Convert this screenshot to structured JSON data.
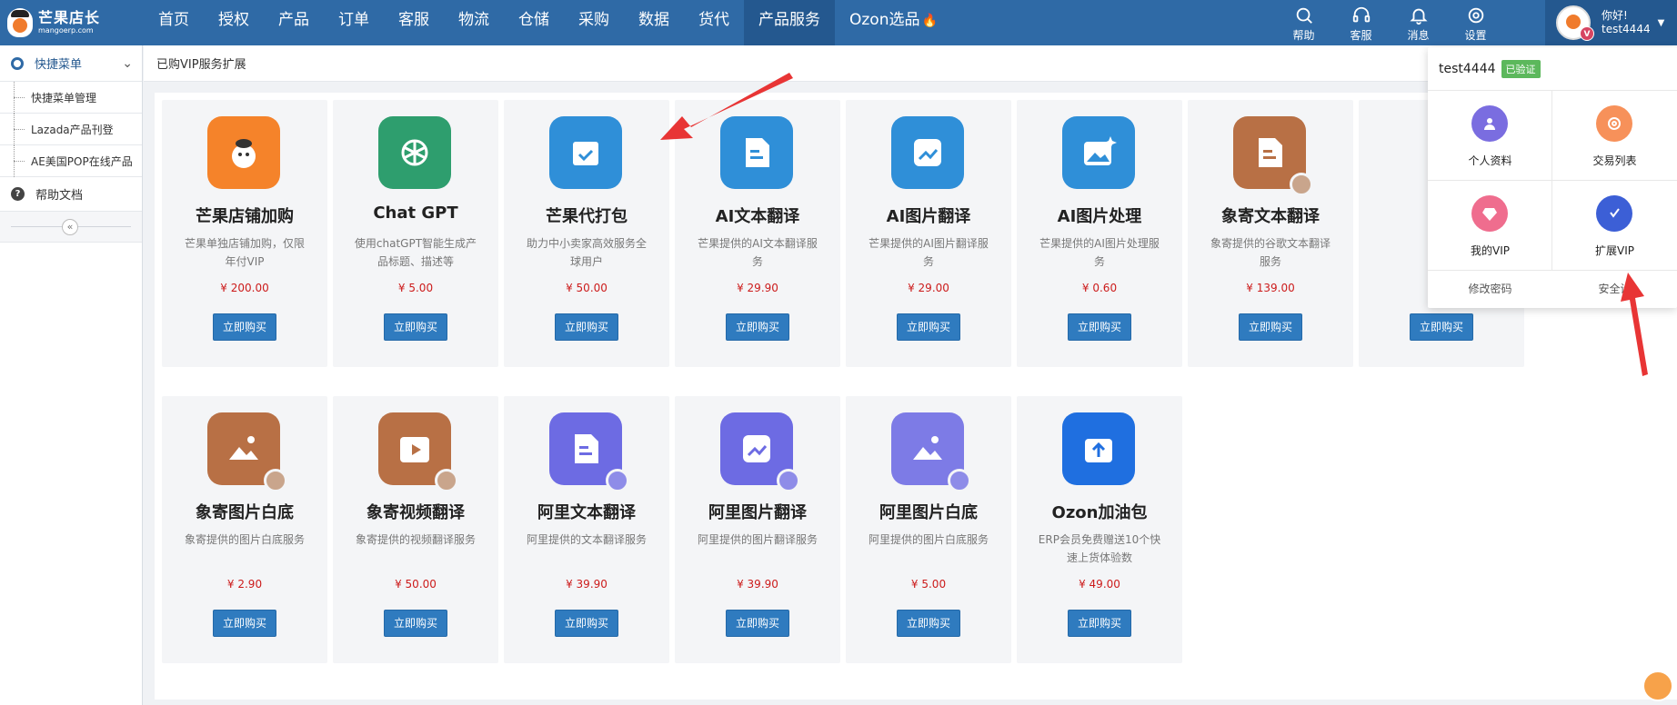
{
  "logo": {
    "title": "芒果店长",
    "subtitle": "mangoerp.com"
  },
  "nav": {
    "items": [
      "首页",
      "授权",
      "产品",
      "订单",
      "客服",
      "物流",
      "仓储",
      "采购",
      "数据",
      "货代",
      "产品服务",
      "Ozon选品"
    ],
    "active": "产品服务"
  },
  "top_icons": {
    "help": "帮助",
    "service": "客服",
    "message": "消息",
    "settings": "设置"
  },
  "user": {
    "greeting": "你好!",
    "name": "test4444",
    "badge": "V"
  },
  "sidebar": {
    "menu_title": "快捷菜单",
    "items": [
      "快捷菜单管理",
      "Lazada产品刊登",
      "AE美国POP在线产品"
    ],
    "help": "帮助文档",
    "collapse": "«"
  },
  "breadcrumb": "已购VIP服务扩展",
  "cards": [
    {
      "title": "芒果店铺加购",
      "desc": "芒果单独店铺加购，仅限年付VIP",
      "price": "¥ 200.00",
      "button": "立即购买",
      "icon": "mango-mascot-icon",
      "color": "#f5832a"
    },
    {
      "title": "Chat GPT",
      "desc": "使用chatGPT智能生成产品标题、描述等",
      "price": "¥ 5.00",
      "button": "立即购买",
      "icon": "chatgpt-icon",
      "color": "#2e9e6e"
    },
    {
      "title": "芒果代打包",
      "desc": "助力中小卖家高效服务全球用户",
      "price": "¥ 50.00",
      "button": "立即购买",
      "icon": "package-check-icon",
      "color": "#2f8fd8"
    },
    {
      "title": "AI文本翻译",
      "desc": "芒果提供的AI文本翻译服务",
      "price": "¥ 29.90",
      "button": "立即购买",
      "icon": "document-icon",
      "color": "#2f8fd8"
    },
    {
      "title": "AI图片翻译",
      "desc": "芒果提供的AI图片翻译服务",
      "price": "¥ 29.00",
      "button": "立即购买",
      "icon": "image-translate-icon",
      "color": "#2f8fd8"
    },
    {
      "title": "AI图片处理",
      "desc": "芒果提供的AI图片处理服务",
      "price": "¥ 0.60",
      "button": "立即购买",
      "icon": "image-sparkle-icon",
      "color": "#2f8fd8"
    },
    {
      "title": "象寄文本翻译",
      "desc": "象寄提供的谷歌文本翻译服务",
      "price": "¥ 139.00",
      "button": "立即购买",
      "icon": "document-icon",
      "color": "#b87045"
    },
    {
      "title": "",
      "desc": "",
      "price": "",
      "button": "立即购买",
      "icon": "",
      "color": "#f4f5f7"
    },
    {
      "title": "象寄图片白底",
      "desc": "象寄提供的图片白底服务",
      "price": "¥ 2.90",
      "button": "立即购买",
      "icon": "image-icon",
      "color": "#b87045"
    },
    {
      "title": "象寄视频翻译",
      "desc": "象寄提供的视频翻译服务",
      "price": "¥ 50.00",
      "button": "立即购买",
      "icon": "video-play-icon",
      "color": "#b87045"
    },
    {
      "title": "阿里文本翻译",
      "desc": "阿里提供的文本翻译服务",
      "price": "¥ 39.90",
      "button": "立即购买",
      "icon": "document-icon",
      "color": "#6d6be3"
    },
    {
      "title": "阿里图片翻译",
      "desc": "阿里提供的图片翻译服务",
      "price": "¥ 39.90",
      "button": "立即购买",
      "icon": "image-translate-icon",
      "color": "#6d6be3"
    },
    {
      "title": "阿里图片白底",
      "desc": "阿里提供的图片白底服务",
      "price": "¥ 5.00",
      "button": "立即购买",
      "icon": "image-icon",
      "color": "#7d7be6"
    },
    {
      "title": "Ozon加油包",
      "desc": "ERP会员免费赠送10个快速上货体验数",
      "price": "¥ 49.00",
      "button": "立即购买",
      "icon": "upload-box-icon",
      "color": "#1f6fe0"
    }
  ],
  "dropdown": {
    "username": "test4444",
    "verified": "已验证",
    "items": [
      {
        "label": "个人资料",
        "color": "#7a6de0"
      },
      {
        "label": "交易列表",
        "color": "#f7915a"
      },
      {
        "label": "我的VIP",
        "color": "#ef6d8e"
      },
      {
        "label": "扩展VIP",
        "color": "#3c5fd6"
      }
    ],
    "bottom_links": [
      "修改密码",
      "安全设"
    ]
  },
  "colors": {
    "nav_bg": "#2f6aa6",
    "button": "#2f7bbf",
    "price": "#cc1b1b",
    "annotation": "#e83535"
  }
}
